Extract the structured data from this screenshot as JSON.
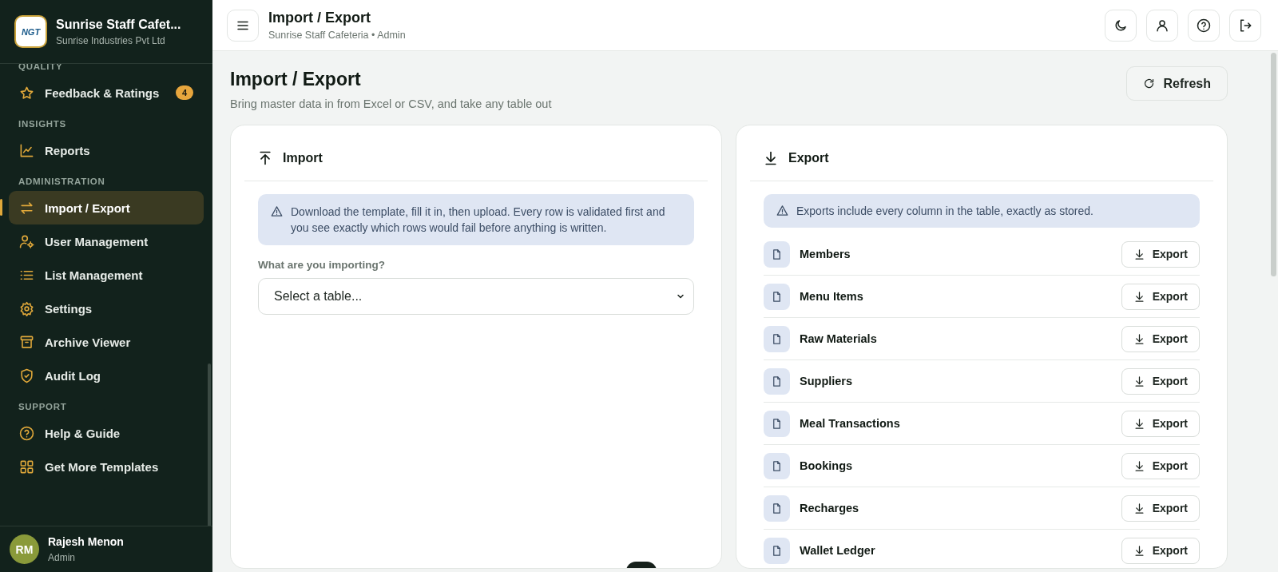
{
  "sidebar": {
    "brand": {
      "logo_text": "NGT",
      "title": "Sunrise Staff Cafet...",
      "subtitle": "Sunrise Industries Pvt Ltd"
    },
    "sections": [
      {
        "label": "QUALITY",
        "items": [
          {
            "label": "Feedback & Ratings",
            "kind": "star",
            "selected": false,
            "badge": "4"
          }
        ]
      },
      {
        "label": "INSIGHTS",
        "items": [
          {
            "label": "Reports",
            "kind": "chart",
            "selected": false
          }
        ]
      },
      {
        "label": "ADMINISTRATION",
        "items": [
          {
            "label": "Import / Export",
            "kind": "swap",
            "selected": true
          },
          {
            "label": "User Management",
            "kind": "usercog",
            "selected": false
          },
          {
            "label": "List Management",
            "kind": "list",
            "selected": false
          },
          {
            "label": "Settings",
            "kind": "gear",
            "selected": false
          },
          {
            "label": "Archive Viewer",
            "kind": "archive",
            "selected": false
          },
          {
            "label": "Audit Log",
            "kind": "shield",
            "selected": false
          }
        ]
      },
      {
        "label": "SUPPORT",
        "items": [
          {
            "label": "Help & Guide",
            "kind": "help",
            "selected": false
          },
          {
            "label": "Get More Templates",
            "kind": "grid",
            "selected": false
          }
        ]
      }
    ],
    "user": {
      "initials": "RM",
      "name": "Rajesh Menon",
      "role": "Admin"
    }
  },
  "header": {
    "title": "Import / Export",
    "subtitle": "Sunrise Staff Cafeteria • Admin",
    "actions": [
      {
        "kind": "moon"
      },
      {
        "kind": "user"
      },
      {
        "kind": "help"
      },
      {
        "kind": "logout"
      }
    ]
  },
  "page": {
    "title": "Import / Export",
    "subtitle": "Bring master data in from Excel or CSV, and take any table out",
    "refresh_button": "Refresh"
  },
  "import_card": {
    "title": "Import",
    "notice": "Download the template, fill it in, then upload. Every row is validated first and you see exactly which rows would fail before anything is written.",
    "field_label": "What are you importing?",
    "select_value": "Select a table..."
  },
  "export_card": {
    "title": "Export",
    "notice": "Exports include every column in the table, exactly as stored.",
    "rows": [
      {
        "name": "Members",
        "button": "Export"
      },
      {
        "name": "Menu Items",
        "button": "Export"
      },
      {
        "name": "Raw Materials",
        "button": "Export"
      },
      {
        "name": "Suppliers",
        "button": "Export"
      },
      {
        "name": "Meal Transactions",
        "button": "Export"
      },
      {
        "name": "Bookings",
        "button": "Export"
      },
      {
        "name": "Recharges",
        "button": "Export"
      },
      {
        "name": "Wallet Ledger",
        "button": "Export"
      }
    ]
  }
}
